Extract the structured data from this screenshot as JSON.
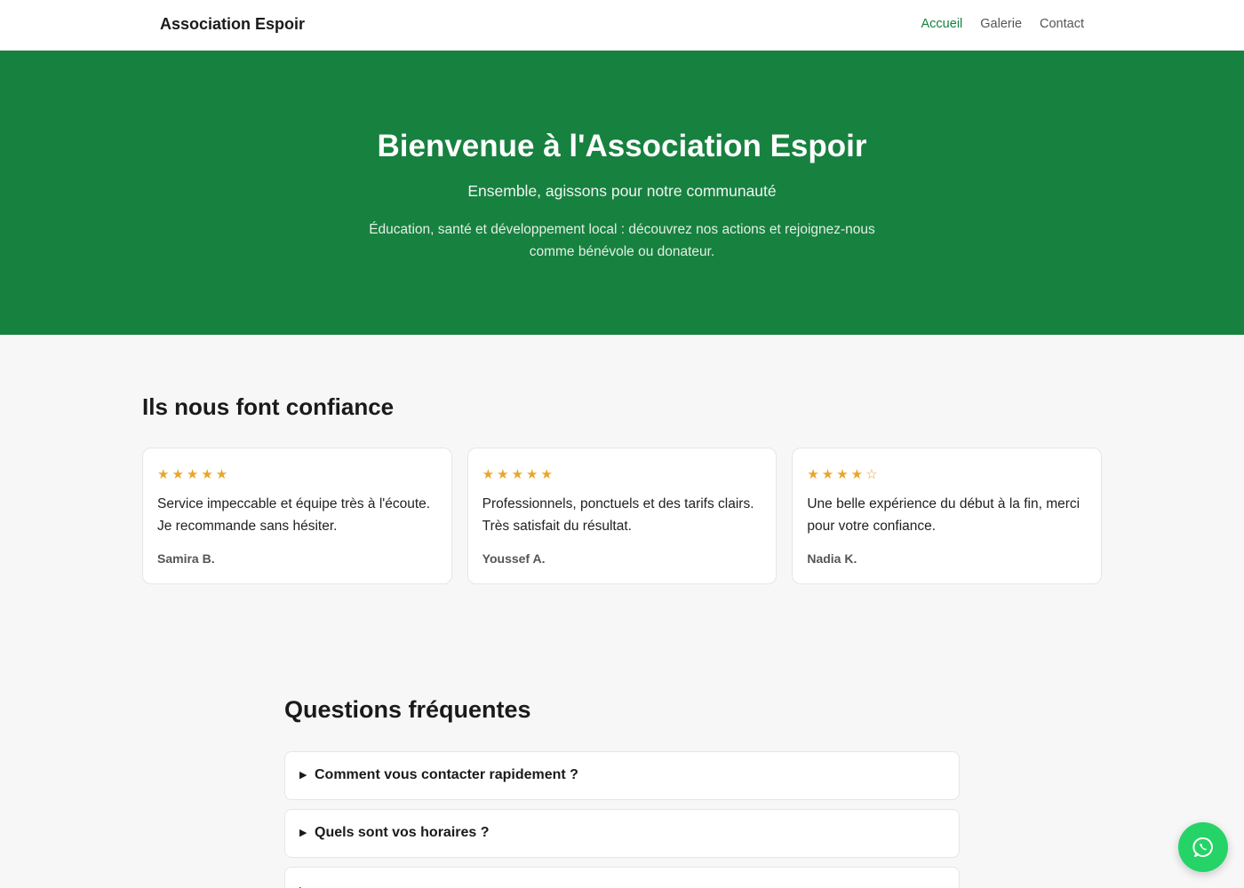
{
  "header": {
    "brand": "Association Espoir",
    "nav": [
      {
        "label": "Accueil",
        "active": true
      },
      {
        "label": "Galerie",
        "active": false
      },
      {
        "label": "Contact",
        "active": false
      }
    ]
  },
  "hero": {
    "title": "Bienvenue à l'Association Espoir",
    "subtitle": "Ensemble, agissons pour notre communauté",
    "description": "Éducation, santé et développement local : découvrez nos actions et rejoignez-nous comme bénévole ou donateur."
  },
  "testimonials": {
    "title": "Ils nous font confiance",
    "items": [
      {
        "stars": "★★★★★",
        "rating": 5,
        "text": "Service impeccable et équipe très à l'écoute. Je recommande sans hésiter.",
        "author": "Samira B."
      },
      {
        "stars": "★★★★★",
        "rating": 5,
        "text": "Professionnels, ponctuels et des tarifs clairs. Très satisfait du résultat.",
        "author": "Youssef A."
      },
      {
        "stars": "★★★★☆",
        "rating": 4,
        "text": "Une belle expérience du début à la fin, merci pour votre confiance.",
        "author": "Nadia K."
      }
    ]
  },
  "faq": {
    "title": "Questions fréquentes",
    "arrow": "▶",
    "items": [
      {
        "question": "Comment vous contacter rapidement ?"
      },
      {
        "question": "Quels sont vos horaires ?"
      },
      {
        "question": ""
      }
    ]
  },
  "floating": {
    "icon": "whatsapp-icon"
  },
  "colors": {
    "brand_green": "#17813f",
    "star": "#e8a72b",
    "whatsapp": "#25d366"
  }
}
